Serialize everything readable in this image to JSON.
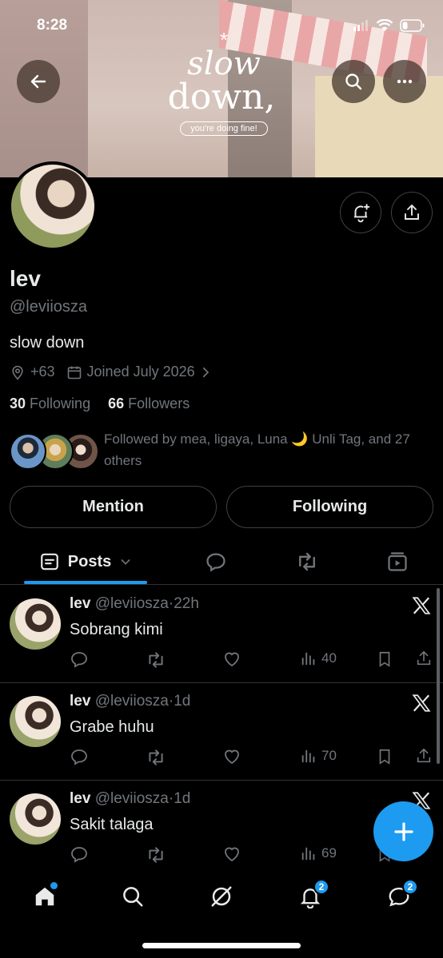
{
  "status_bar": {
    "time": "8:28"
  },
  "banner": {
    "slogan_line1": "slow",
    "slogan_line2": "down,",
    "slogan_tag": "you're doing fine!"
  },
  "profile": {
    "name": "lev",
    "handle": "@leviiosza",
    "bio": "slow down",
    "location": "+63",
    "joined": "Joined July 2026",
    "following_count": "30",
    "following_label": "Following",
    "followers_count": "66",
    "followers_label": "Followers",
    "followed_by": "Followed by mea, ligaya, Luna 🌙 Unli Tag, and 27 others"
  },
  "buttons": {
    "mention": "Mention",
    "following": "Following"
  },
  "tabs": {
    "posts": "Posts"
  },
  "posts": [
    {
      "name": "lev",
      "handle": "@leviiosza",
      "sep": "·",
      "time": "22h",
      "text": "Sobrang kimi",
      "views": "40"
    },
    {
      "name": "lev",
      "handle": "@leviiosza",
      "sep": "·",
      "time": "1d",
      "text": "Grabe huhu",
      "views": "70"
    },
    {
      "name": "lev",
      "handle": "@leviiosza",
      "sep": "·",
      "time": "1d",
      "text": "Sakit talaga",
      "views": "69"
    }
  ],
  "nav": {
    "notifications_badge": "2",
    "messages_badge": "2"
  },
  "colors": {
    "accent": "#1d9bf0",
    "muted": "#71767b",
    "text": "#e7e9ea",
    "border": "#2f3336"
  }
}
